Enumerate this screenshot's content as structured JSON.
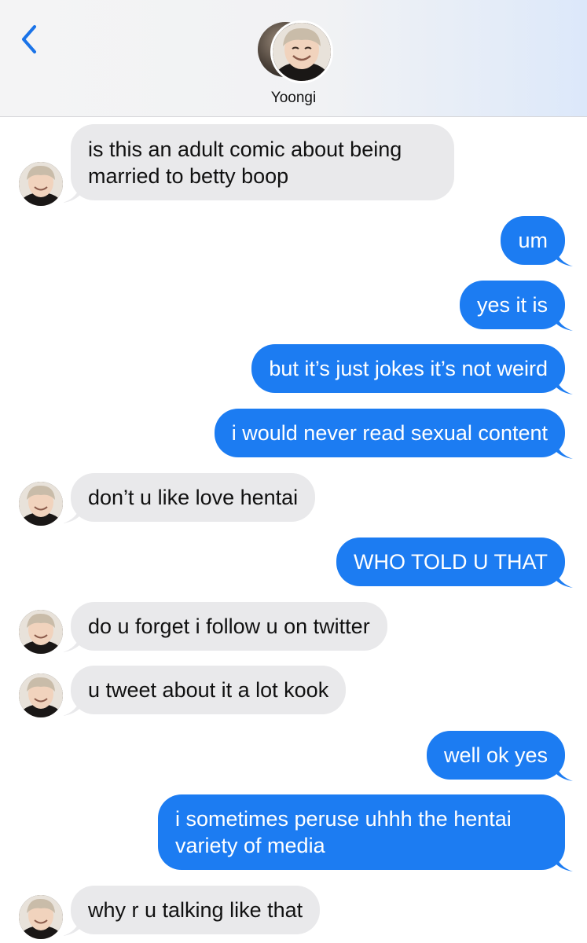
{
  "header": {
    "contact_name": "Yoongi"
  },
  "colors": {
    "outgoing_bubble": "#1c7cf2",
    "incoming_bubble": "#e9e9eb",
    "accent": "#1a73e8"
  },
  "icons": {
    "back": "chevron-left-icon"
  },
  "messages": [
    {
      "side": "in",
      "text": "is this an adult comic about being\nmarried to betty boop"
    },
    {
      "side": "out",
      "text": "um"
    },
    {
      "side": "out",
      "text": "yes it is"
    },
    {
      "side": "out",
      "text": "but it’s just jokes it’s not weird"
    },
    {
      "side": "out",
      "text": "i would never read sexual content"
    },
    {
      "side": "in",
      "text": "don’t u like love hentai"
    },
    {
      "side": "out",
      "text": "WHO TOLD U THAT"
    },
    {
      "side": "in",
      "text": "do u forget i follow u on twitter"
    },
    {
      "side": "in",
      "text": "u tweet about it a lot kook"
    },
    {
      "side": "out",
      "text": "well ok yes"
    },
    {
      "side": "out",
      "text": "i sometimes peruse uhhh the hentai\nvariety of media"
    },
    {
      "side": "in",
      "text": "why r u talking like that"
    }
  ]
}
